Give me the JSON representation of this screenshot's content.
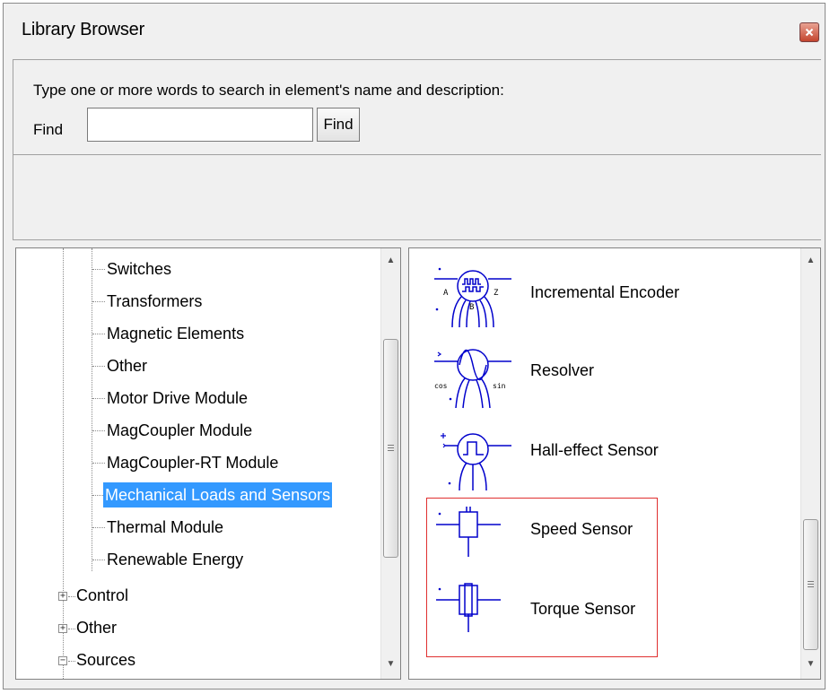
{
  "window": {
    "title": "Library Browser",
    "close_icon": "close-icon",
    "accent_close": "#c4452f"
  },
  "search": {
    "hint": "Type one or more words to search in element's name and  description:",
    "find_label": "Find",
    "input_value": "",
    "button_label": "Find"
  },
  "tree": {
    "items": [
      {
        "label": "Switches",
        "selected": false
      },
      {
        "label": "Transformers",
        "selected": false
      },
      {
        "label": "Magnetic Elements",
        "selected": false
      },
      {
        "label": "Other",
        "selected": false
      },
      {
        "label": "Motor Drive Module",
        "selected": false
      },
      {
        "label": "MagCoupler Module",
        "selected": false
      },
      {
        "label": "MagCoupler-RT Module",
        "selected": false
      },
      {
        "label": "Mechanical Loads and Sensors",
        "selected": true
      },
      {
        "label": "Thermal Module",
        "selected": false
      },
      {
        "label": "Renewable Energy",
        "selected": false
      }
    ],
    "groups": [
      {
        "label": "Control",
        "expander": "+"
      },
      {
        "label": "Other",
        "expander": "+"
      },
      {
        "label": "Sources",
        "expander": "−"
      }
    ],
    "selection_color": "#3399ff"
  },
  "elements": {
    "items": [
      {
        "label": "Incremental Encoder",
        "icon": "incremental-encoder-icon",
        "icon_labels": [
          "A",
          "B",
          "Z"
        ]
      },
      {
        "label": "Resolver",
        "icon": "resolver-icon",
        "icon_labels": [
          "cos",
          "sin"
        ]
      },
      {
        "label": "Hall-effect Sensor",
        "icon": "hall-effect-sensor-icon"
      },
      {
        "label": "Speed Sensor",
        "icon": "speed-sensor-icon"
      },
      {
        "label": "Torque Sensor",
        "icon": "torque-sensor-icon"
      }
    ],
    "icon_color": "#0000cc",
    "highlight_color": "#e03030"
  }
}
